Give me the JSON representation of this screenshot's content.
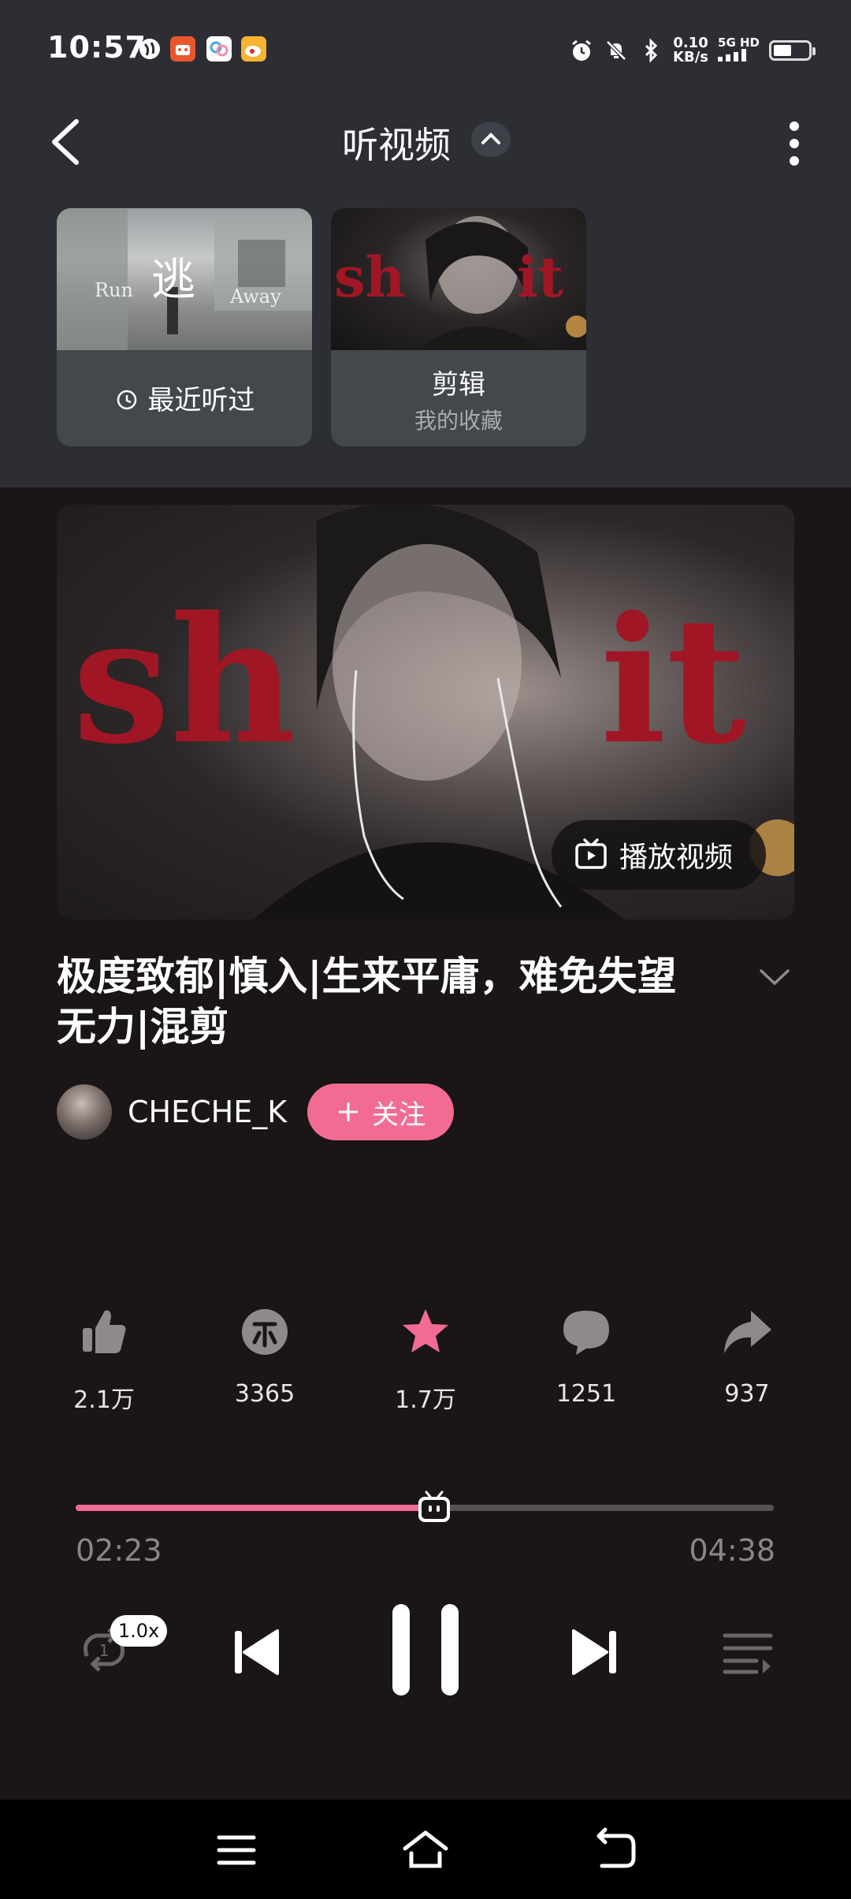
{
  "status_bar": {
    "time": "10:57",
    "net_speed_top": "0.10",
    "net_speed_unit": "KB/s",
    "network": "5G HD"
  },
  "header": {
    "title": "听视频"
  },
  "cards": [
    {
      "label": "最近听过",
      "thumb_text_1": "Run",
      "thumb_text_2": "逃",
      "thumb_text_3": "Away"
    },
    {
      "title": "剪辑",
      "subtitle": "我的收藏",
      "thumb_text_left": "sh",
      "thumb_text_right": "it"
    }
  ],
  "video": {
    "overlay_left": "sh",
    "overlay_right": "it",
    "play_video_label": "播放视频"
  },
  "song": {
    "title": "极度致郁|慎入|生来平庸，难免失望无力|混剪"
  },
  "author": {
    "name": "CHECHE_K",
    "follow_label": "关注"
  },
  "stats": {
    "like": "2.1万",
    "coin": "3365",
    "favorite": "1.7万",
    "comment": "1251",
    "share": "937"
  },
  "player": {
    "current_time": "02:23",
    "total_time": "04:38",
    "progress": 0.513,
    "speed": "1.0x",
    "loop_count": "1"
  },
  "colors": {
    "accent": "#f26b92",
    "top_bg": "#2c2e33",
    "main_bg": "#1a1516"
  }
}
